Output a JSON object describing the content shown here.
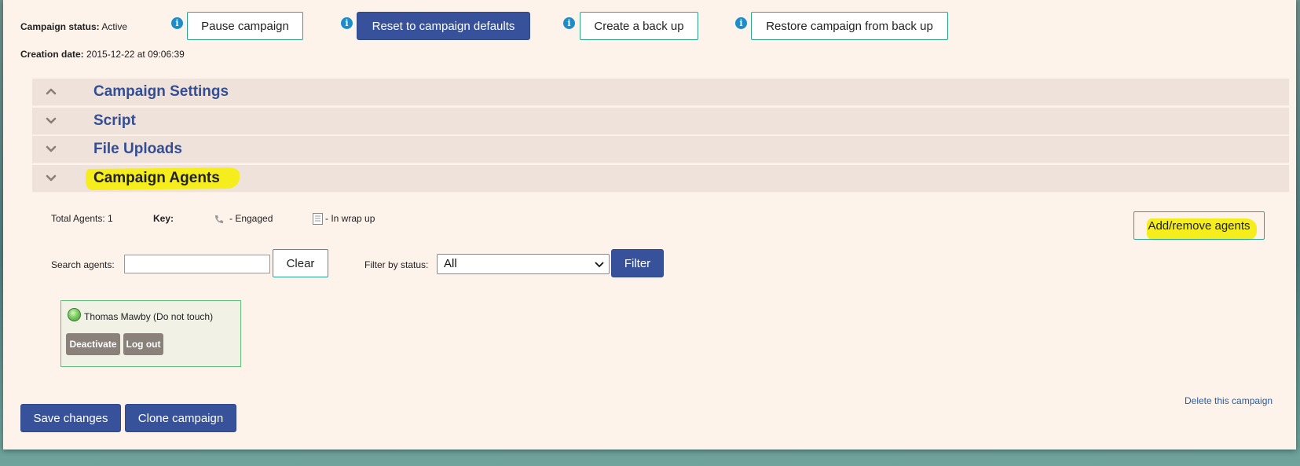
{
  "header": {
    "status_label": "Campaign status:",
    "status_value": "Active",
    "creation_label": "Creation date:",
    "creation_value": "2015-12-22 at 09:06:39"
  },
  "toolbar": {
    "info_glyph": "i",
    "pause": "Pause campaign",
    "reset": "Reset to campaign defaults",
    "backup": "Create a back up",
    "restore": "Restore campaign from back up"
  },
  "accordion": [
    {
      "title": "Campaign Settings",
      "state": "expanded-up-chevron"
    },
    {
      "title": "Script",
      "state": "collapsed"
    },
    {
      "title": "File Uploads",
      "state": "collapsed"
    },
    {
      "title": "Campaign Agents",
      "state": "active-highlighted"
    }
  ],
  "agents": {
    "total_label": "Total Agents: 1",
    "key_label": "Key:",
    "engaged_label": "- Engaged",
    "wrapup_label": "- In wrap up",
    "add_remove": "Add/remove agents",
    "search_label": "Search agents:",
    "search_value": "",
    "clear": "Clear",
    "filter_label": "Filter by status:",
    "filter_selected": "All",
    "filter_button": "Filter",
    "list": [
      {
        "name": "Thomas Mawby (Do not touch)",
        "status": "online",
        "deactivate": "Deactivate",
        "logout": "Log out"
      }
    ]
  },
  "footer": {
    "save": "Save changes",
    "clone": "Clone campaign",
    "delete": "Delete this campaign"
  },
  "colors": {
    "panel_bg": "#fef3eb",
    "primary_button": "#37529a",
    "outline_border": "#2aa58c",
    "accordion_bg": "#efe2db",
    "accordion_title": "#344e93",
    "highlight": "#f5ee1c",
    "info_icon": "#1d8cc9",
    "agent_card_border": "#62c07f",
    "agent_button": "#8a817b"
  }
}
